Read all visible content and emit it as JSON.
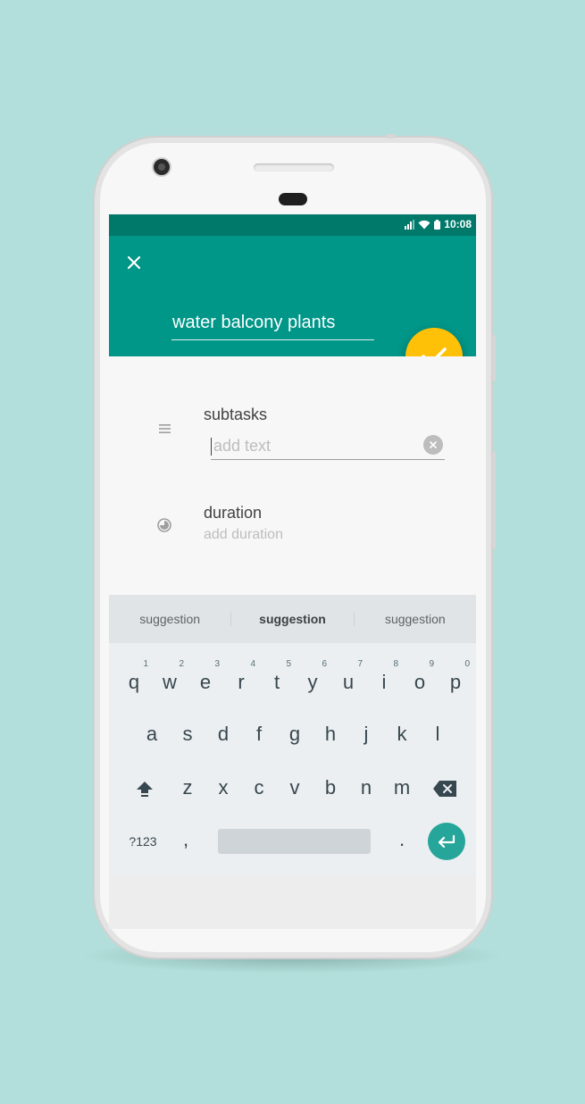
{
  "statusbar": {
    "time": "10:08"
  },
  "task": {
    "title": "water balcony plants"
  },
  "subtasks": {
    "label": "subtasks",
    "placeholder": "add text"
  },
  "duration": {
    "label": "duration",
    "hint": "add duration"
  },
  "suggestions": [
    "suggestion",
    "suggestion",
    "suggestion"
  ],
  "keyboard": {
    "row1": [
      "q",
      "w",
      "e",
      "r",
      "t",
      "y",
      "u",
      "i",
      "o",
      "p"
    ],
    "row1_digits": [
      "1",
      "2",
      "3",
      "4",
      "5",
      "6",
      "7",
      "8",
      "9",
      "0"
    ],
    "row2": [
      "a",
      "s",
      "d",
      "f",
      "g",
      "h",
      "j",
      "k",
      "l"
    ],
    "row3": [
      "z",
      "x",
      "c",
      "v",
      "b",
      "n",
      "m"
    ],
    "symbols_label": "?123",
    "comma": ",",
    "period": "."
  },
  "colors": {
    "primary": "#009688",
    "primary_dark": "#00796b",
    "accent": "#ffc107",
    "background": "#b2dfdb"
  },
  "icons": {
    "close": "close-icon",
    "fab": "check-icon",
    "subtasks": "list-icon",
    "duration": "timer-icon",
    "clear": "clear-icon",
    "shift": "shift-icon",
    "backspace": "backspace-icon",
    "enter": "enter-icon"
  }
}
